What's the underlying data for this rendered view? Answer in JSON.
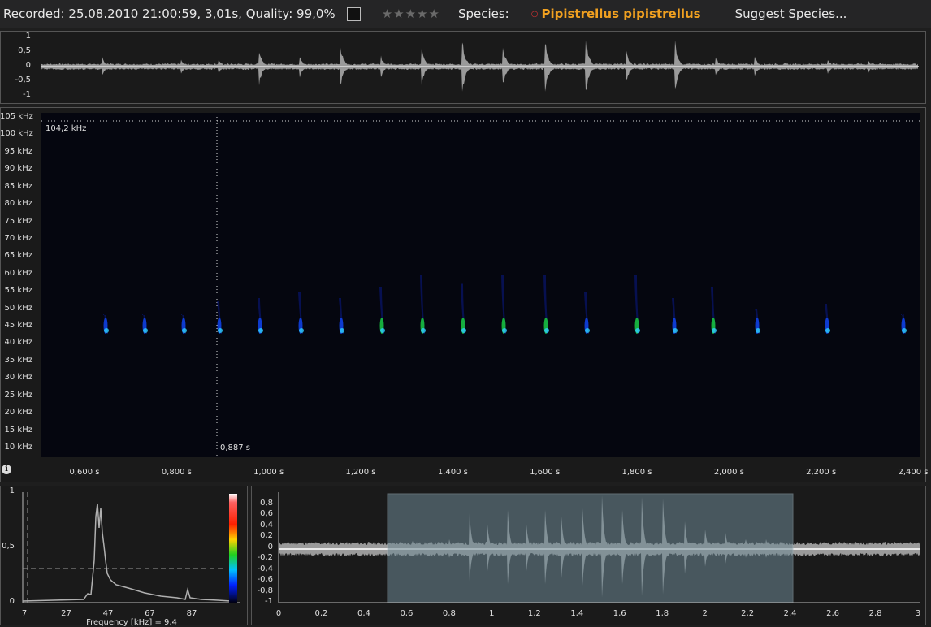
{
  "header": {
    "recorded": "Recorded: 25.08.2010 21:00:59, 3,01s, Quality: 99,0%",
    "stars": "★★★★★",
    "species_label": "Species:",
    "species_name": "Pipistrellus pipistrellus",
    "suggest": "Suggest Species..."
  },
  "waveform_top": {
    "y_ticks": [
      "1",
      "0,5",
      "0",
      "-0,5",
      "-1"
    ]
  },
  "spectrogram": {
    "y_ticks": [
      "105 kHz",
      "100 kHz",
      "95 kHz",
      "90 kHz",
      "85 kHz",
      "80 kHz",
      "75 kHz",
      "70 kHz",
      "65 kHz",
      "60 kHz",
      "55 kHz",
      "50 kHz",
      "45 kHz",
      "40 kHz",
      "35 kHz",
      "30 kHz",
      "25 kHz",
      "20 kHz",
      "15 kHz",
      "10 kHz"
    ],
    "x_ticks": [
      "0,600 s",
      "0,800 s",
      "1,000 s",
      "1,200 s",
      "1,400 s",
      "1,600 s",
      "1,800 s",
      "2,000 s",
      "2,200 s",
      "2,400 s"
    ],
    "cursor_freq": "104,2 kHz",
    "cursor_time": "0,887 s"
  },
  "spectrum": {
    "y_ticks": [
      "1",
      "0,5",
      "0"
    ],
    "x_ticks": [
      "7",
      "27",
      "47",
      "67",
      "87"
    ],
    "xlabel": "Frequency [kHz] = 9,4"
  },
  "overview": {
    "y_ticks": [
      "0,8",
      "0,6",
      "0,4",
      "0,2",
      "0",
      "-0,2",
      "-0,4",
      "-0,6",
      "-0,8",
      "-1"
    ],
    "x_ticks": [
      "0",
      "0,2",
      "0,4",
      "0,6",
      "0,8",
      "1",
      "1,2",
      "1,4",
      "1,6",
      "1,8",
      "2",
      "2,2",
      "2,4",
      "2,6",
      "2,8",
      "3"
    ]
  },
  "colors": {
    "accent": "#f0a020",
    "selection": "#6f8a96"
  }
}
